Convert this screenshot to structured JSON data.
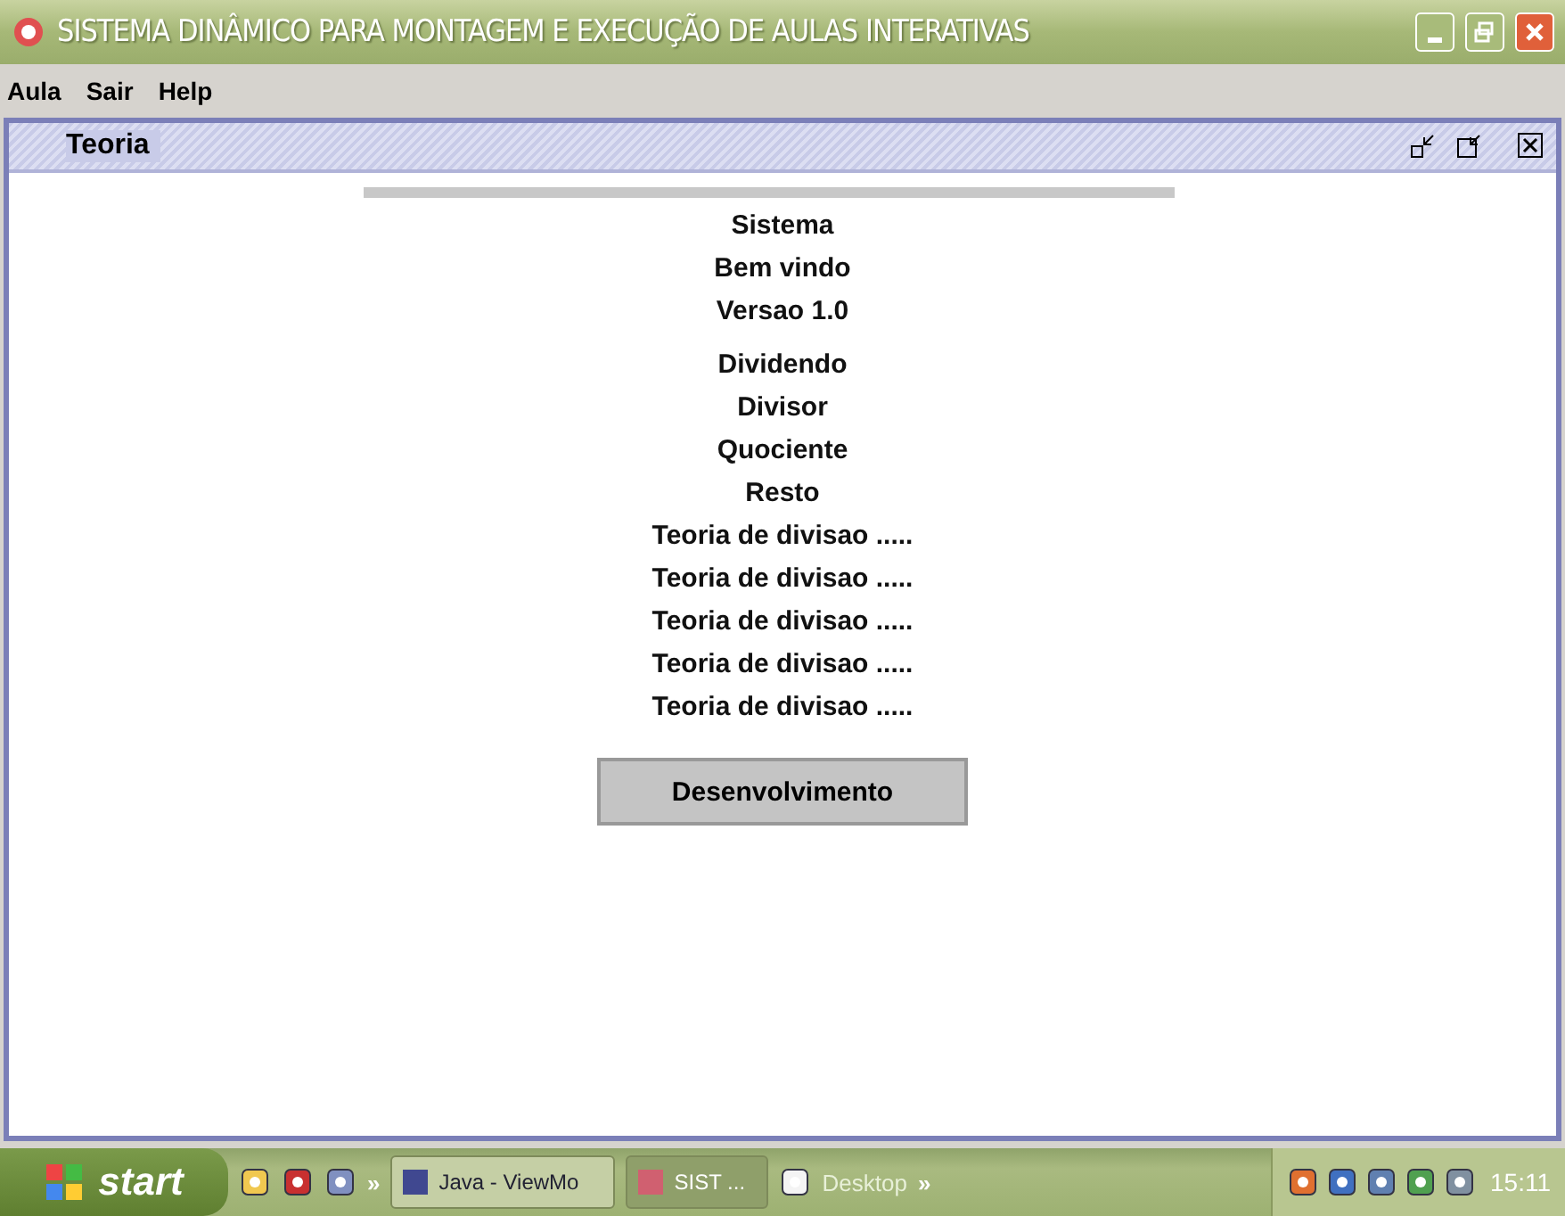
{
  "window": {
    "title": "SISTEMA DINÂMICO PARA MONTAGEM E EXECUÇÃO DE AULAS INTERATIVAS"
  },
  "menu": [
    "Aula",
    "Sair",
    "Help"
  ],
  "frame": {
    "title": "Teoria"
  },
  "header_lines": [
    "Sistema",
    "Bem vindo",
    "Versao 1.0"
  ],
  "body_lines": [
    "Dividendo",
    "Divisor",
    "Quociente",
    "Resto",
    "Teoria de divisao .....",
    "Teoria de divisao .....",
    "Teoria de divisao .....",
    "Teoria de divisao .....",
    "Teoria de divisao ....."
  ],
  "button": {
    "label": "Desenvolvimento"
  },
  "taskbar": {
    "start": "start",
    "chevron_1": "»",
    "tasks": [
      {
        "label": "Java - ViewMo",
        "selected": false
      },
      {
        "label": "SIST ...",
        "selected": true
      }
    ],
    "toolbar": "Desktop",
    "chevron_2": "»",
    "clock": "15:11"
  }
}
